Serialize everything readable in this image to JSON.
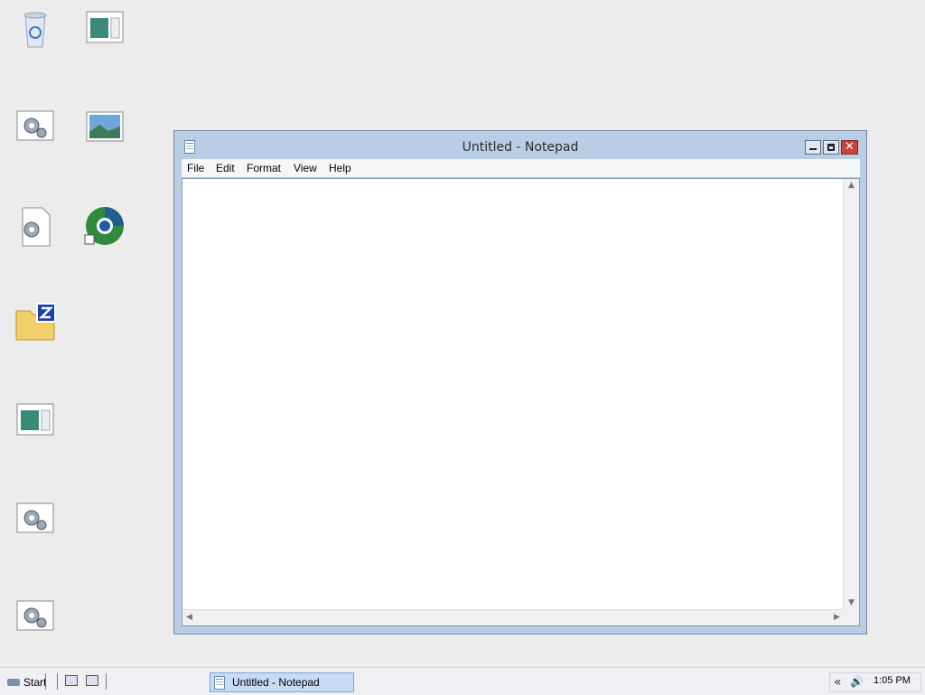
{
  "desktop": {
    "icons": [
      {
        "label": ""
      },
      {
        "label": ""
      },
      {
        "label": ""
      },
      {
        "label": ""
      },
      {
        "label": ""
      },
      {
        "label": ""
      },
      {
        "label": ""
      },
      {
        "label": ""
      },
      {
        "label": ""
      },
      {
        "label": ""
      }
    ]
  },
  "window": {
    "title": "Untitled - Notepad",
    "menu": [
      "File",
      "Edit",
      "Format",
      "View",
      "Help"
    ],
    "content": "",
    "controls": {
      "close": "✕"
    }
  },
  "scrollbar": {
    "up": "▲",
    "down": "▼",
    "left": "◀",
    "right": "▶"
  },
  "taskbar": {
    "start_label": "Start",
    "task_label": "Untitled - Notepad",
    "tray": {
      "chevron": "«",
      "volume": "🔊",
      "clock": "1:05 PM"
    }
  },
  "colors": {
    "accent": "#b8cde6",
    "close": "#c7443a",
    "taskbar": "#eef0f3"
  },
  "icons": [
    "recycle-bin-icon",
    "window-icon",
    "settings-icon",
    "image-icon",
    "document-settings-icon",
    "browser-icon",
    "folder-icon"
  ]
}
